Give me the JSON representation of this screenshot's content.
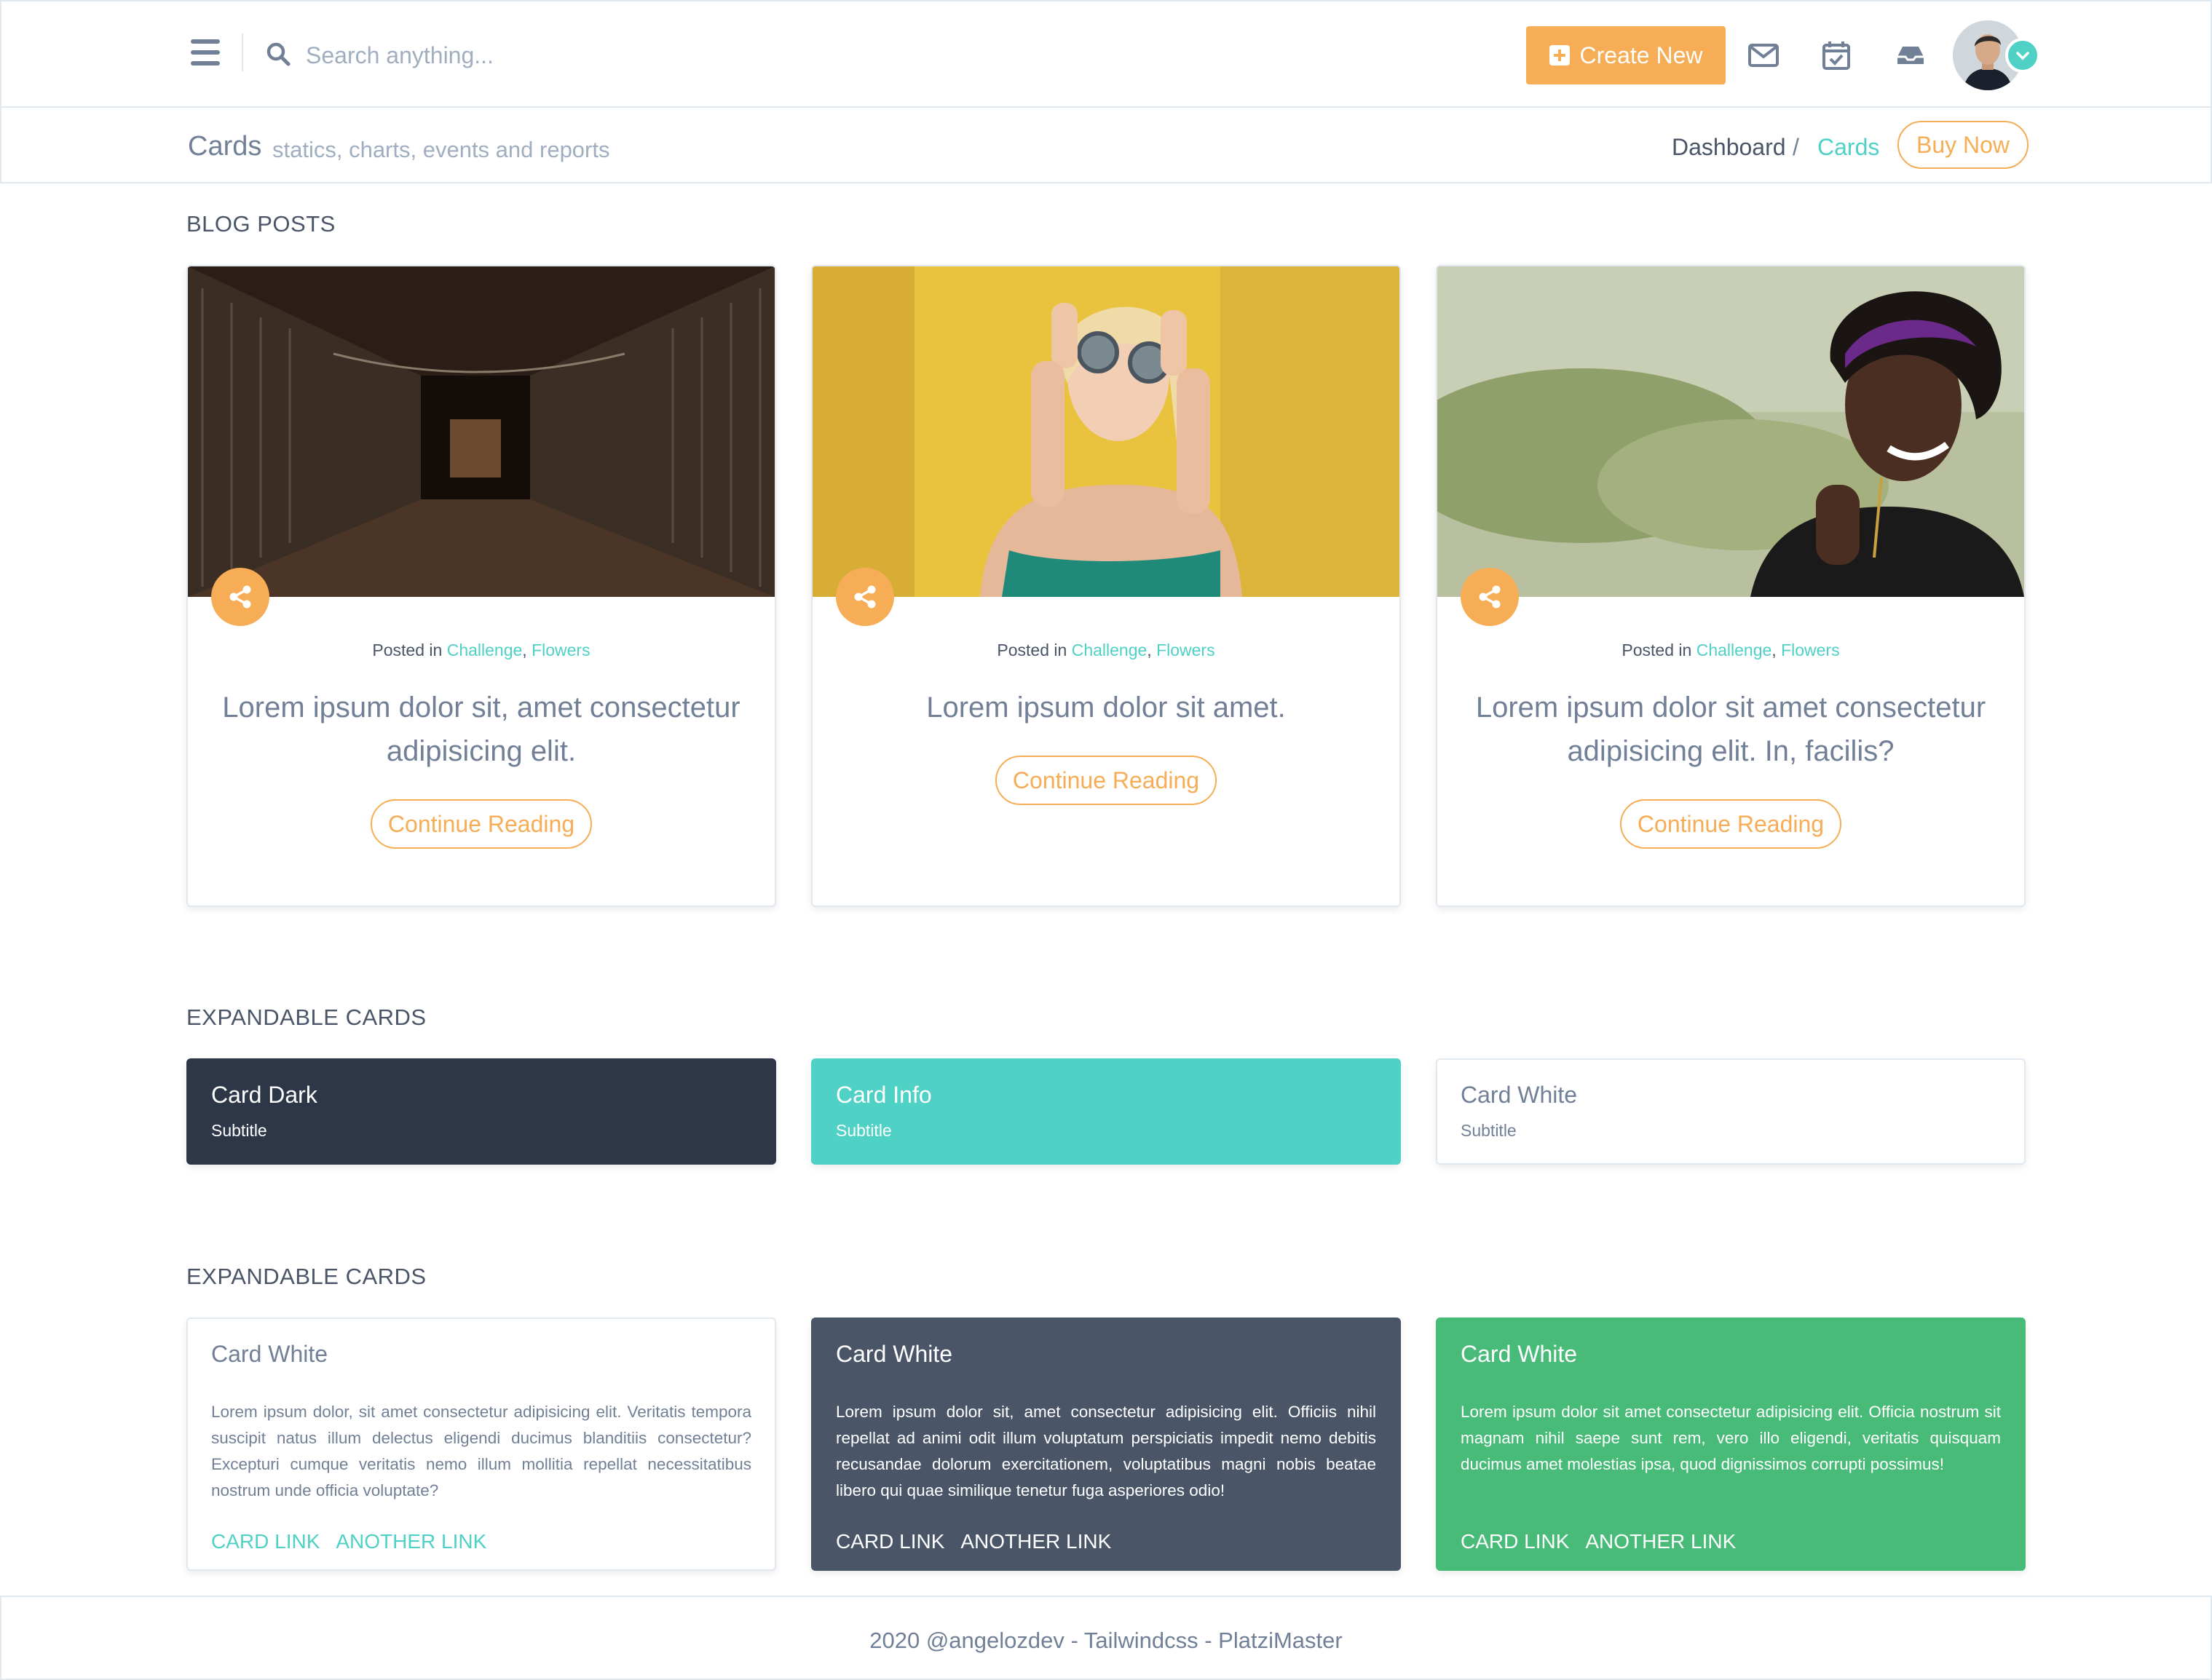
{
  "header": {
    "search_placeholder": "Search anything...",
    "create_label": "Create New",
    "icons": [
      "menu-icon",
      "search-icon",
      "mail-icon",
      "calendar-check-icon",
      "inbox-icon",
      "chevron-down-icon"
    ]
  },
  "subheader": {
    "title": "Cards",
    "subtitle": "statics, charts, events and reports",
    "breadcrumb": {
      "home": "Dashboard",
      "separator": "/",
      "current": "Cards"
    },
    "buy_label": "Buy Now"
  },
  "blog": {
    "section_title": "BLOG POSTS",
    "posted_prefix": "Posted in",
    "cards": [
      {
        "tags": [
          "Challenge",
          "Flowers"
        ],
        "title": "Lorem ipsum dolor sit, amet consectetur adipisicing elit.",
        "button": "Continue Reading"
      },
      {
        "tags": [
          "Challenge",
          "Flowers"
        ],
        "title": "Lorem ipsum dolor sit amet.",
        "button": "Continue Reading"
      },
      {
        "tags": [
          "Challenge",
          "Flowers"
        ],
        "title": "Lorem ipsum dolor sit amet consectetur adipisicing elit. In, facilis?",
        "button": "Continue Reading"
      }
    ]
  },
  "expandable1": {
    "section_title": "EXPANDABLE CARDS",
    "cards": [
      {
        "title": "Card Dark",
        "subtitle": "Subtitle"
      },
      {
        "title": "Card Info",
        "subtitle": "Subtitle"
      },
      {
        "title": "Card White",
        "subtitle": "Subtitle"
      }
    ]
  },
  "expandable2": {
    "section_title": "EXPANDABLE CARDS",
    "cards": [
      {
        "title": "Card White",
        "body": "Lorem ipsum dolor, sit amet consectetur adipisicing elit. Veritatis tempora suscipit natus illum delectus eligendi ducimus blanditiis consectetur? Excepturi cumque veritatis nemo illum mollitia repellat necessitatibus nostrum unde officia voluptate?",
        "link1": "CARD LINK",
        "link2": "ANOTHER LINK"
      },
      {
        "title": "Card White",
        "body": "Lorem ipsum dolor sit, amet consectetur adipisicing elit. Officiis nihil repellat ad animi odit illum voluptatum perspiciatis impedit nemo debitis recusandae dolorum exercitationem, voluptatibus magni nobis beatae libero qui quae similique tenetur fuga asperiores odio!",
        "link1": "CARD LINK",
        "link2": "ANOTHER LINK"
      },
      {
        "title": "Card White",
        "body": "Lorem ipsum dolor sit amet consectetur adipisicing elit. Officia nostrum sit magnam nihil saepe sunt rem, vero illo eligendi, veritatis quisquam ducimus amet molestias ipsa, quod dignissimos corrupti possimus!",
        "link1": "CARD LINK",
        "link2": "ANOTHER LINK"
      }
    ]
  },
  "footer": {
    "text": "2020 @angelozdev - Tailwindcss - PlatziMaster"
  },
  "colors": {
    "accent_orange": "#f6ad55",
    "teal": "#4fd1c5",
    "dark": "#2d3748",
    "slate": "#4a5568",
    "green": "#48bb78"
  }
}
